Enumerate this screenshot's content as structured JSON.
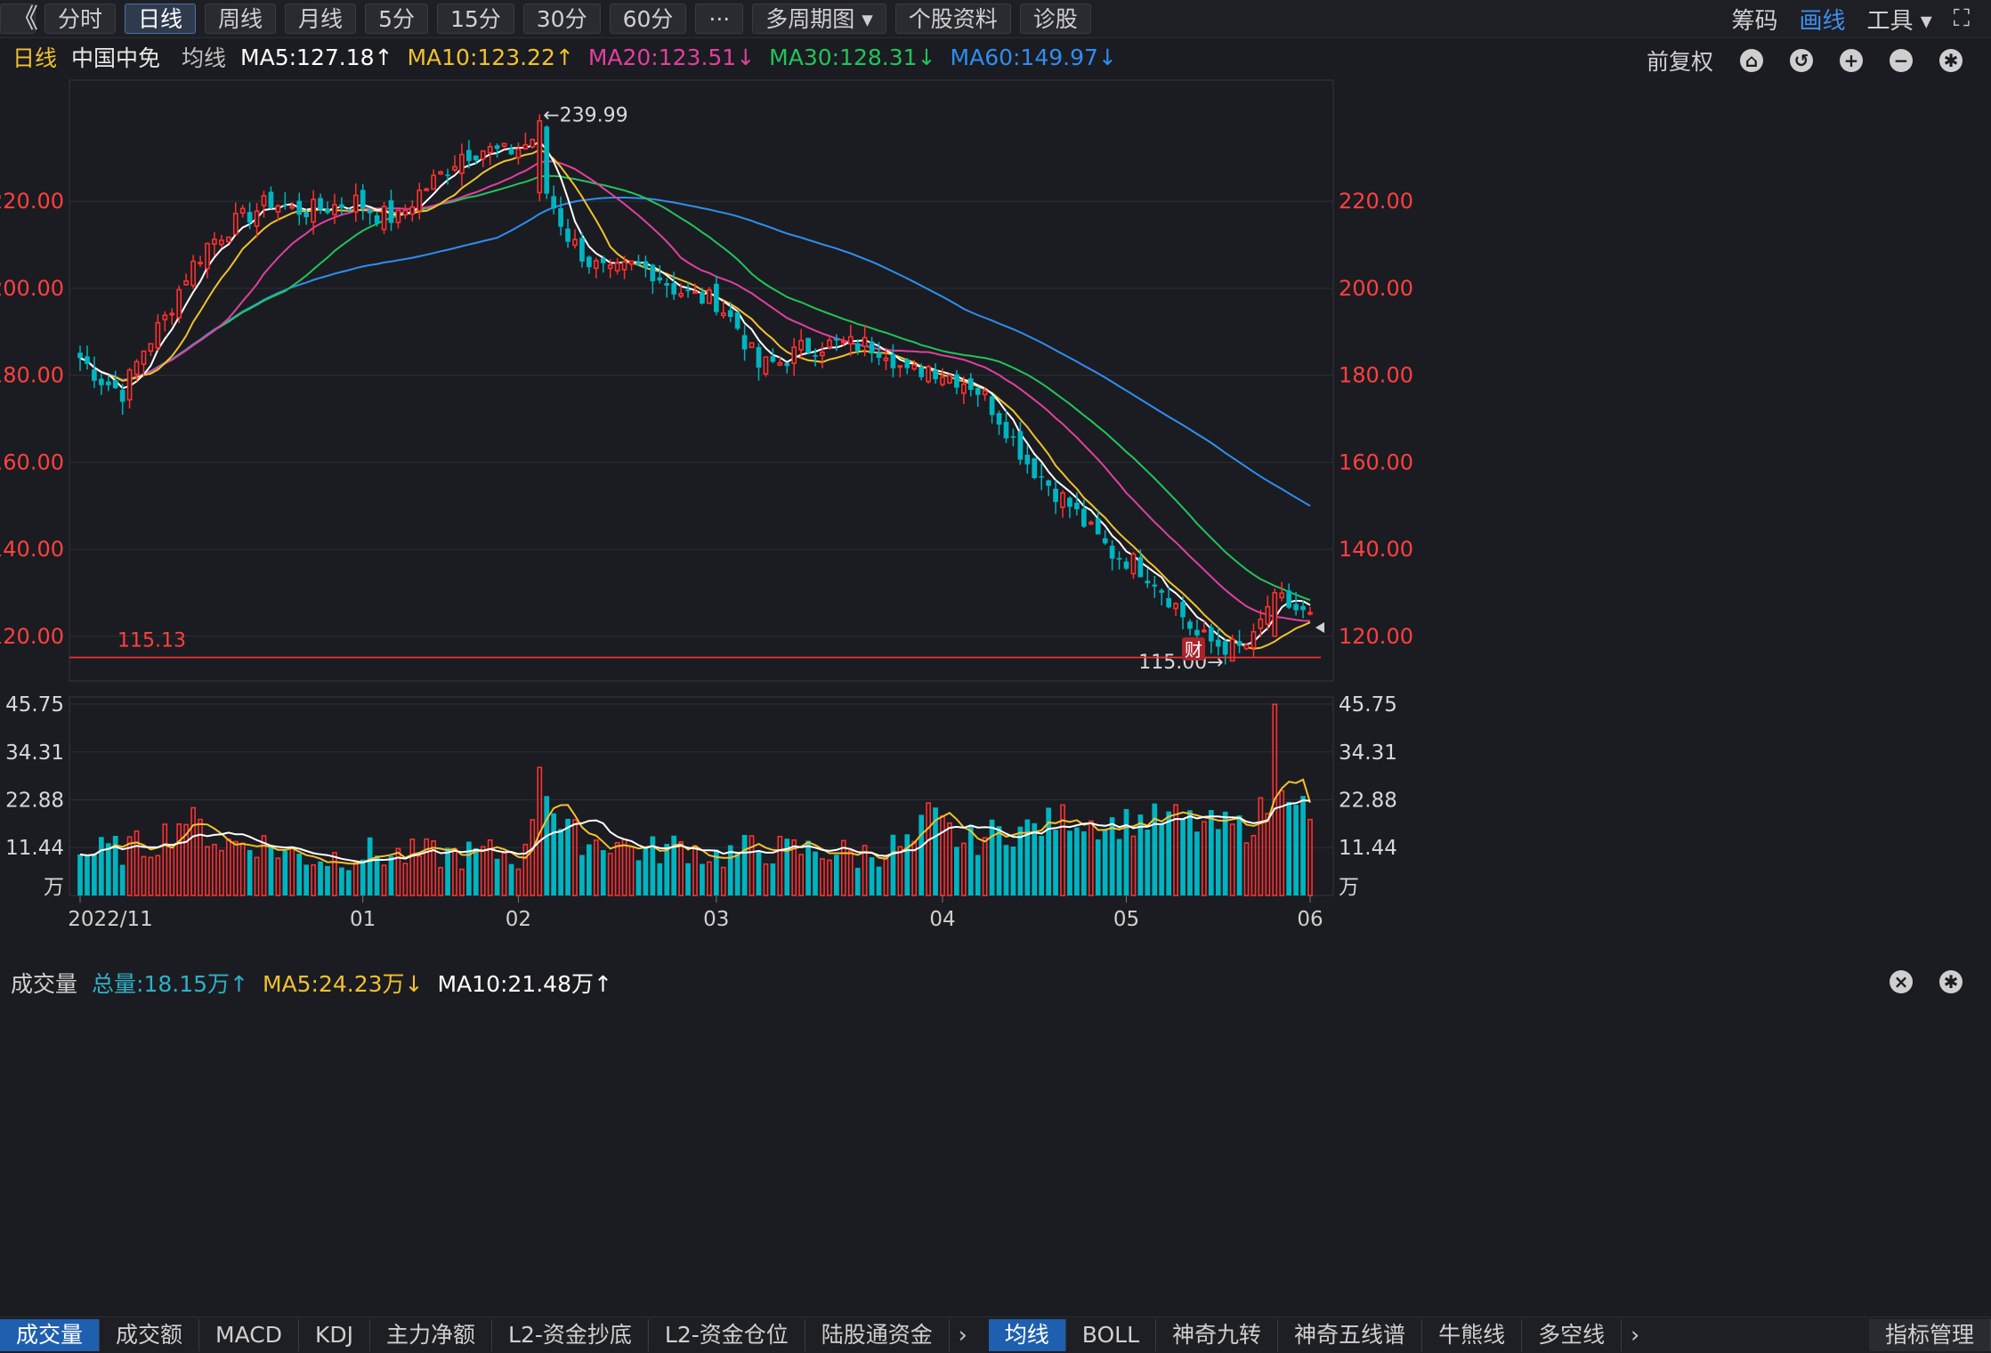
{
  "toolbar": {
    "back_icon": "chevrons-left-icon",
    "periods": [
      "分时",
      "日线",
      "周线",
      "月线",
      "5分",
      "15分",
      "30分",
      "60分",
      "···",
      "多周期图 ▾",
      "个股资料",
      "诊股"
    ],
    "active_period": "日线",
    "right": [
      "筹码",
      "画线",
      "工具 ▾"
    ],
    "right_active": "画线"
  },
  "mabar": {
    "period": "日线",
    "stock_name": "中国中免",
    "label": "均线",
    "ma5": "MA5:127.18↑",
    "ma10": "MA10:123.22↑",
    "ma20": "MA20:123.51↓",
    "ma30": "MA30:128.31↓",
    "ma60": "MA60:149.97↓",
    "adjust": "前复权"
  },
  "volbar": {
    "title": "成交量",
    "total": "总量:18.15万↑",
    "ma5": "MA5:24.23万↓",
    "ma10": "MA10:21.48万↑"
  },
  "colors": {
    "up": "#ff3030",
    "down": "#00b4c0",
    "ma5": "#ffffff",
    "ma10": "#f2c12e",
    "ma20": "#e040a0",
    "ma30": "#22c45a",
    "ma60": "#2f8ef0",
    "axis_label": "#ff4040",
    "vol_axis_label": "#d8d8d8"
  },
  "chart_data": {
    "type": "candlestick",
    "price_axis": {
      "ticks": [
        "220.00",
        "200.00",
        "180.00",
        "160.00",
        "140.00",
        "120.00"
      ],
      "ylim": [
        113,
        245
      ]
    },
    "volume_axis": {
      "ticks": [
        "45.75",
        "34.31",
        "22.88",
        "11.44"
      ],
      "unit": "万",
      "ylim": [
        0,
        45.75
      ]
    },
    "x_ticks": [
      "2022/11",
      "01",
      "02",
      "03",
      "04",
      "05",
      "06"
    ],
    "annotations": {
      "high_label": "←239.99",
      "low_label": "115.00→",
      "ref_line_value": 115.13,
      "ref_line_label": "115.13",
      "news_badge": "财"
    },
    "anchors": [
      [
        0,
        184
      ],
      [
        3,
        179
      ],
      [
        6,
        176
      ],
      [
        9,
        186
      ],
      [
        12,
        193
      ],
      [
        15,
        203
      ],
      [
        18,
        210
      ],
      [
        21,
        214
      ],
      [
        24,
        217
      ],
      [
        27,
        220
      ],
      [
        30,
        218
      ],
      [
        33,
        218
      ],
      [
        36,
        219
      ],
      [
        39,
        220
      ],
      [
        42,
        217
      ],
      [
        45,
        216
      ],
      [
        48,
        222
      ],
      [
        51,
        226
      ],
      [
        54,
        231
      ],
      [
        57,
        232
      ],
      [
        60,
        231
      ],
      [
        63,
        233
      ],
      [
        65,
        236
      ],
      [
        66,
        222
      ],
      [
        69,
        212
      ],
      [
        72,
        206
      ],
      [
        75,
        203
      ],
      [
        78,
        205
      ],
      [
        81,
        204
      ],
      [
        84,
        200
      ],
      [
        87,
        198
      ],
      [
        90,
        197
      ],
      [
        93,
        191
      ],
      [
        96,
        182
      ],
      [
        99,
        183
      ],
      [
        102,
        186
      ],
      [
        105,
        187
      ],
      [
        108,
        187
      ],
      [
        111,
        187
      ],
      [
        114,
        186
      ],
      [
        117,
        180
      ],
      [
        120,
        182
      ],
      [
        123,
        180
      ],
      [
        126,
        178
      ],
      [
        128,
        175
      ],
      [
        131,
        168
      ],
      [
        134,
        160
      ],
      [
        137,
        155
      ],
      [
        140,
        150
      ],
      [
        143,
        144
      ],
      [
        146,
        139
      ],
      [
        149,
        137
      ],
      [
        152,
        133
      ],
      [
        155,
        127
      ],
      [
        158,
        120
      ],
      [
        161,
        118
      ],
      [
        164,
        117
      ],
      [
        166,
        119
      ],
      [
        168,
        127
      ],
      [
        170,
        128
      ],
      [
        172,
        126
      ],
      [
        174,
        124
      ]
    ],
    "volume_anchors": [
      [
        0,
        9.1
      ],
      [
        5,
        10.0
      ],
      [
        10,
        11.3
      ],
      [
        15,
        17.8
      ],
      [
        20,
        11.6
      ],
      [
        25,
        11.9
      ],
      [
        30,
        9.0
      ],
      [
        35,
        8.2
      ],
      [
        40,
        9.6
      ],
      [
        45,
        8.6
      ],
      [
        50,
        8.9
      ],
      [
        55,
        9.0
      ],
      [
        60,
        9.2
      ],
      [
        63,
        8.4
      ],
      [
        65,
        30.6
      ],
      [
        68,
        15.0
      ],
      [
        72,
        12.1
      ],
      [
        76,
        12.0
      ],
      [
        80,
        9.5
      ],
      [
        85,
        11.2
      ],
      [
        90,
        8.6
      ],
      [
        95,
        10.4
      ],
      [
        100,
        9.8
      ],
      [
        105,
        10.1
      ],
      [
        110,
        8.7
      ],
      [
        115,
        10.8
      ],
      [
        118,
        11.5
      ],
      [
        120,
        18.5
      ],
      [
        125,
        11.6
      ],
      [
        130,
        14.5
      ],
      [
        135,
        15.4
      ],
      [
        140,
        18.1
      ],
      [
        145,
        16.1
      ],
      [
        150,
        17.2
      ],
      [
        155,
        17.6
      ],
      [
        160,
        15.7
      ],
      [
        165,
        15.5
      ],
      [
        168,
        20.8
      ],
      [
        169,
        45.7
      ],
      [
        170,
        27.4
      ],
      [
        172,
        23.5
      ],
      [
        174,
        18.15
      ]
    ],
    "ma_ends": {
      "MA5": 127.18,
      "MA10": 123.22,
      "MA20": 123.51,
      "MA30": 128.31,
      "MA60": 149.97
    }
  },
  "bottom_tabs": {
    "left": [
      "成交量",
      "成交额",
      "MACD",
      "KDJ",
      "主力净额",
      "L2-资金抄底",
      "L2-资金仓位",
      "陆股通资金"
    ],
    "left_active": "成交量",
    "right": [
      "均线",
      "BOLL",
      "神奇九转",
      "神奇五线谱",
      "牛熊线",
      "多空线"
    ],
    "right_active": "均线",
    "manage": "指标管理"
  }
}
